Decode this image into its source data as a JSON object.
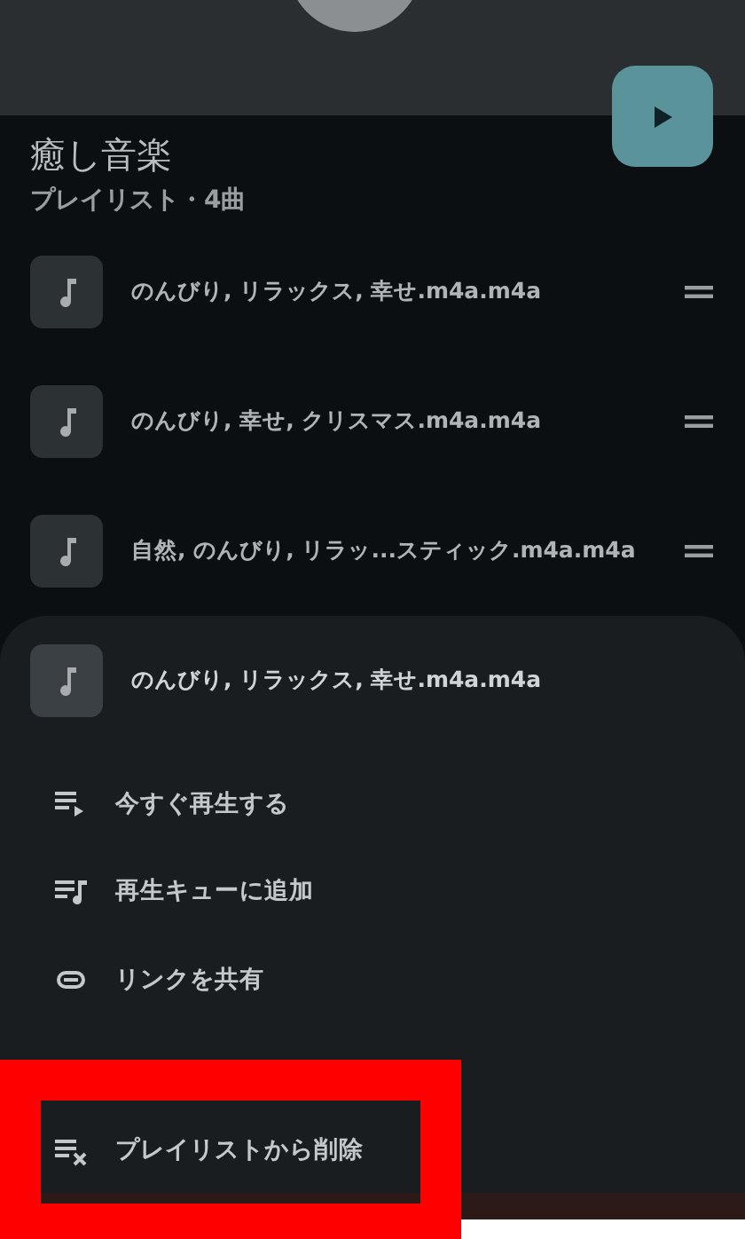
{
  "playlist": {
    "title": "癒し音楽",
    "subtitle": "プレイリスト・4曲"
  },
  "tracks": [
    {
      "title": "のんびり, リラックス, 幸せ.m4a.m4a"
    },
    {
      "title": "のんびり, 幸せ, クリスマス.m4a.m4a"
    },
    {
      "title": "自然, のんびり, リラッ...スティック.m4a.m4a"
    }
  ],
  "sheet": {
    "track_title": "のんびり, リラックス, 幸せ.m4a.m4a",
    "actions": [
      {
        "kind": "play-next",
        "label": "今すぐ再生する"
      },
      {
        "kind": "queue",
        "label": "再生キューに追加"
      },
      {
        "kind": "link",
        "label": "リンクを共有"
      },
      {
        "kind": "remove",
        "label": "プレイリストから削除"
      }
    ]
  },
  "annotation": {
    "kind": "highlight-frame"
  }
}
